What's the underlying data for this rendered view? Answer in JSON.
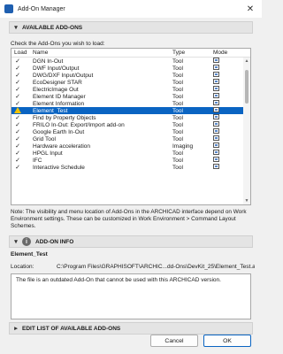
{
  "window": {
    "title": "Add-On Manager",
    "close_glyph": "✕"
  },
  "available": {
    "header": "AVAILABLE ADD-ONS",
    "prompt": "Check the Add-Ons you wish to load:"
  },
  "table": {
    "columns": [
      "Load",
      "Name",
      "Type",
      "Mode"
    ],
    "rows": [
      {
        "load": "checked",
        "name": "DGN In-Out",
        "type": "Tool"
      },
      {
        "load": "checked",
        "name": "DWF Input/Output",
        "type": "Tool"
      },
      {
        "load": "checked",
        "name": "DWG/DXF Input/Output",
        "type": "Tool"
      },
      {
        "load": "checked",
        "name": "EcoDesigner STAR",
        "type": "Tool"
      },
      {
        "load": "checked",
        "name": "ElectricImage Out",
        "type": "Tool"
      },
      {
        "load": "checked",
        "name": "Element ID Manager",
        "type": "Tool"
      },
      {
        "load": "checked",
        "name": "Element Information",
        "type": "Tool"
      },
      {
        "load": "warning",
        "name": "Element_Test",
        "type": "Tool",
        "selected": true
      },
      {
        "load": "checked",
        "name": "Find by Property Objects",
        "type": "Tool"
      },
      {
        "load": "checked",
        "name": "FRILO In-Out: Export/Import add-on",
        "type": "Tool"
      },
      {
        "load": "checked",
        "name": "Google Earth In-Out",
        "type": "Tool"
      },
      {
        "load": "checked",
        "name": "Grid Tool",
        "type": "Tool"
      },
      {
        "load": "checked",
        "name": "Hardware acceleration",
        "type": "Imaging"
      },
      {
        "load": "checked",
        "name": "HPGL Input",
        "type": "Tool"
      },
      {
        "load": "checked",
        "name": "IFC",
        "type": "Tool"
      },
      {
        "load": "checked",
        "name": "Interactive Schedule",
        "type": "Tool"
      }
    ]
  },
  "note": "Note: The visibility and menu location of Add-Ons in the ARCHICAD interface depend on Work Environment settings. These can be customized in Work Environment > Command Layout Schemes.",
  "info": {
    "header": "ADD-ON INFO",
    "addon_name": "Element_Test",
    "location_label": "Location:",
    "location_value": "C:\\Program Files\\GRAPHISOFT\\ARCHIC...dd-Ons\\DevKit_25\\Element_Test.apx",
    "message": "The file is an outdated Add-On that cannot be used with this ARCHICAD version."
  },
  "edit_list": {
    "header": "EDIT LIST OF AVAILABLE ADD-ONS"
  },
  "buttons": {
    "cancel": "Cancel",
    "ok": "OK"
  },
  "icons": {
    "check": "✓",
    "chevron_down": "▾",
    "chevron_right": "▸",
    "scroll_up": "▲",
    "scroll_down": "▼",
    "info": "i"
  },
  "colors": {
    "selection": "#0a64c2",
    "warning": "#f2c200"
  }
}
